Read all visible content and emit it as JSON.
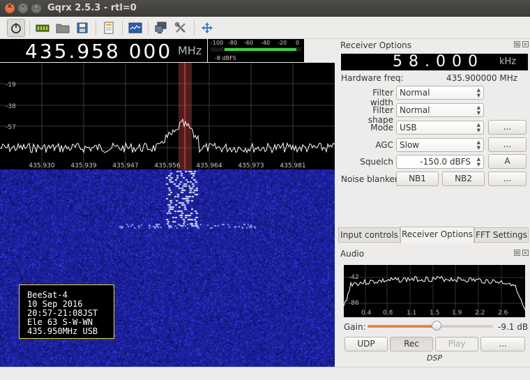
{
  "window": {
    "title": "Gqrx 2.5.3 - rtl=0",
    "close_glyph": "×",
    "min_glyph": "–",
    "max_glyph": "□"
  },
  "toolbar": {
    "items": [
      "power-icon",
      "hardware-icon",
      "open-icon",
      "save-icon",
      "note-icon",
      "display-icon",
      "network-icon",
      "tools-icon",
      "move-icon"
    ]
  },
  "frequency": {
    "digits": "435.958 000",
    "unit": "MHz"
  },
  "smeter": {
    "ticks": [
      "-100",
      "-80",
      "-60",
      "-40",
      "-20",
      "0"
    ],
    "level_label": "-8 dBFS",
    "level_fraction": 0.95
  },
  "spectrum": {
    "y_labels": [
      "-19",
      "-38",
      "-57"
    ],
    "x_labels": [
      "435.930",
      "435.939",
      "435.947",
      "435.956",
      "435.964",
      "435.973",
      "435.981"
    ],
    "channel_color": "#b04040"
  },
  "overlay": {
    "lines": [
      "BeeSat-4",
      "10 Sep 2016",
      "20:57-21:08JST",
      "Ele 63 S-W-WN",
      "435.950MHz USB"
    ]
  },
  "receiver": {
    "title": "Receiver Options",
    "lnb_digits": "58.000",
    "lnb_unit": "kHz",
    "hardware_label": "Hardware freq:",
    "hardware_value": "435.900000 MHz",
    "filter_width_label": "Filter width",
    "filter_width_value": "Normal",
    "filter_shape_label": "Filter shape",
    "filter_shape_value": "Normal",
    "mode_label": "Mode",
    "mode_value": "USB",
    "agc_label": "AGC",
    "agc_value": "Slow",
    "squelch_label": "Squelch",
    "squelch_value": "-150.0 dBFS",
    "squelch_button": "A",
    "nb_label": "Noise blanker",
    "nb1": "NB1",
    "nb2": "NB2",
    "more_button": "..."
  },
  "tabs": {
    "input": "Input controls",
    "receiver": "Receiver Options",
    "fft": "FFT Settings"
  },
  "audio": {
    "title": "Audio",
    "y_labels": [
      "-42",
      "-86"
    ],
    "x_labels": [
      "0.4",
      "0.8",
      "1.1",
      "1.5",
      "1.9",
      "2.2",
      "2.6"
    ],
    "gain_label": "Gain:",
    "gain_value": "-9.1 dB",
    "gain_fraction": 0.55,
    "udp": "UDP",
    "rec": "Rec",
    "play": "Play",
    "more": "...",
    "dsp": "DSP"
  },
  "colors": {
    "accent": "#e8834b",
    "meter_green": "#3bd33b",
    "waterfall_bg": "#1a1d9a"
  }
}
